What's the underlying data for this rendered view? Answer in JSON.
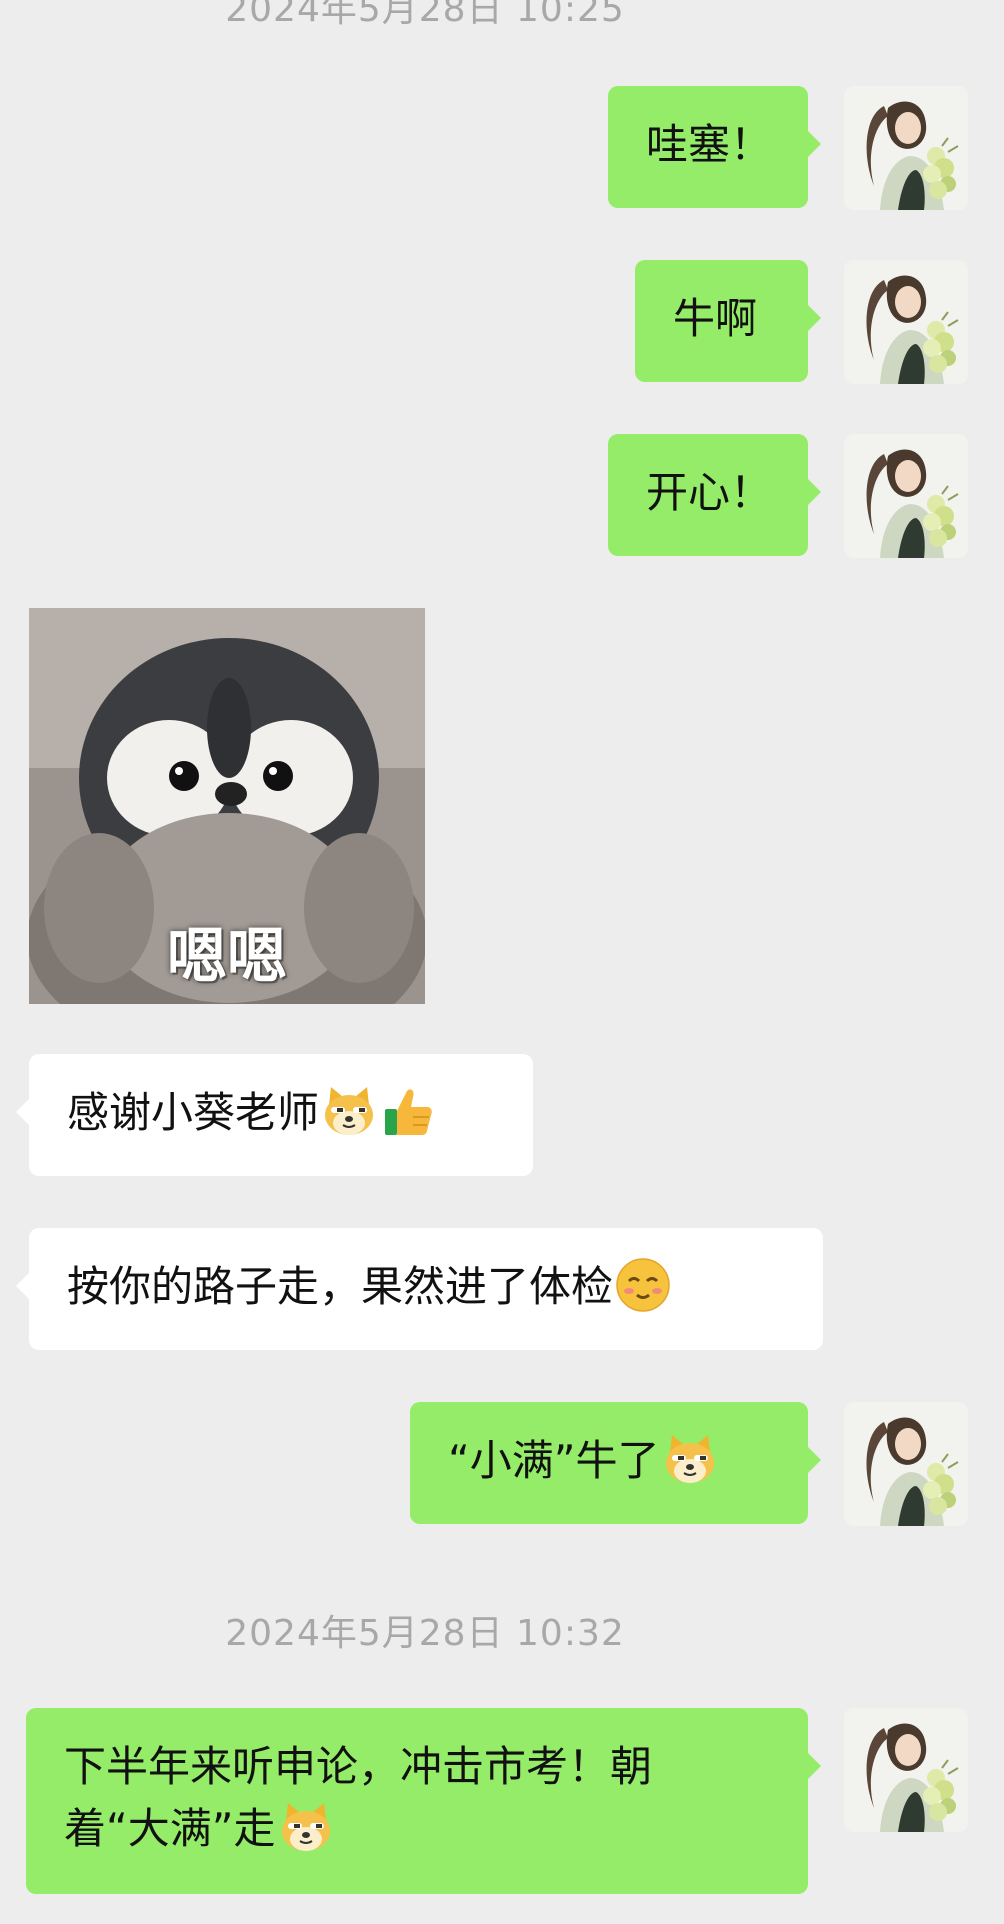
{
  "timestamps": [
    "2024年5月28日 10:25",
    "2024年5月28日 10:32"
  ],
  "messages": [
    {
      "side": "out",
      "text": "哇塞！"
    },
    {
      "side": "out",
      "text": "牛啊"
    },
    {
      "side": "out",
      "text": "开心！"
    },
    {
      "side": "in",
      "type": "sticker",
      "caption": "嗯嗯",
      "icon": "penguin-sticker"
    },
    {
      "side": "in",
      "text": "感谢小葵老师",
      "emojis": [
        "doge-emoji",
        "thumbs-up-emoji"
      ]
    },
    {
      "side": "in",
      "text": "按你的路子走，果然进了体检",
      "emojis": [
        "smile-emoji"
      ]
    },
    {
      "side": "out",
      "text": "“小满”牛了",
      "emojis": [
        "doge-emoji"
      ]
    },
    {
      "side": "out",
      "text_line1": "下半年来听申论，冲击市考！朝",
      "text_line2": "着“大满”走",
      "emojis": [
        "doge-emoji"
      ]
    }
  ],
  "avatar": {
    "icon": "girl-with-flowers-avatar"
  },
  "colors": {
    "outgoing_bubble": "#95ec69",
    "incoming_bubble": "#ffffff",
    "background": "#ededed",
    "timestamp": "#a8a8a8"
  }
}
